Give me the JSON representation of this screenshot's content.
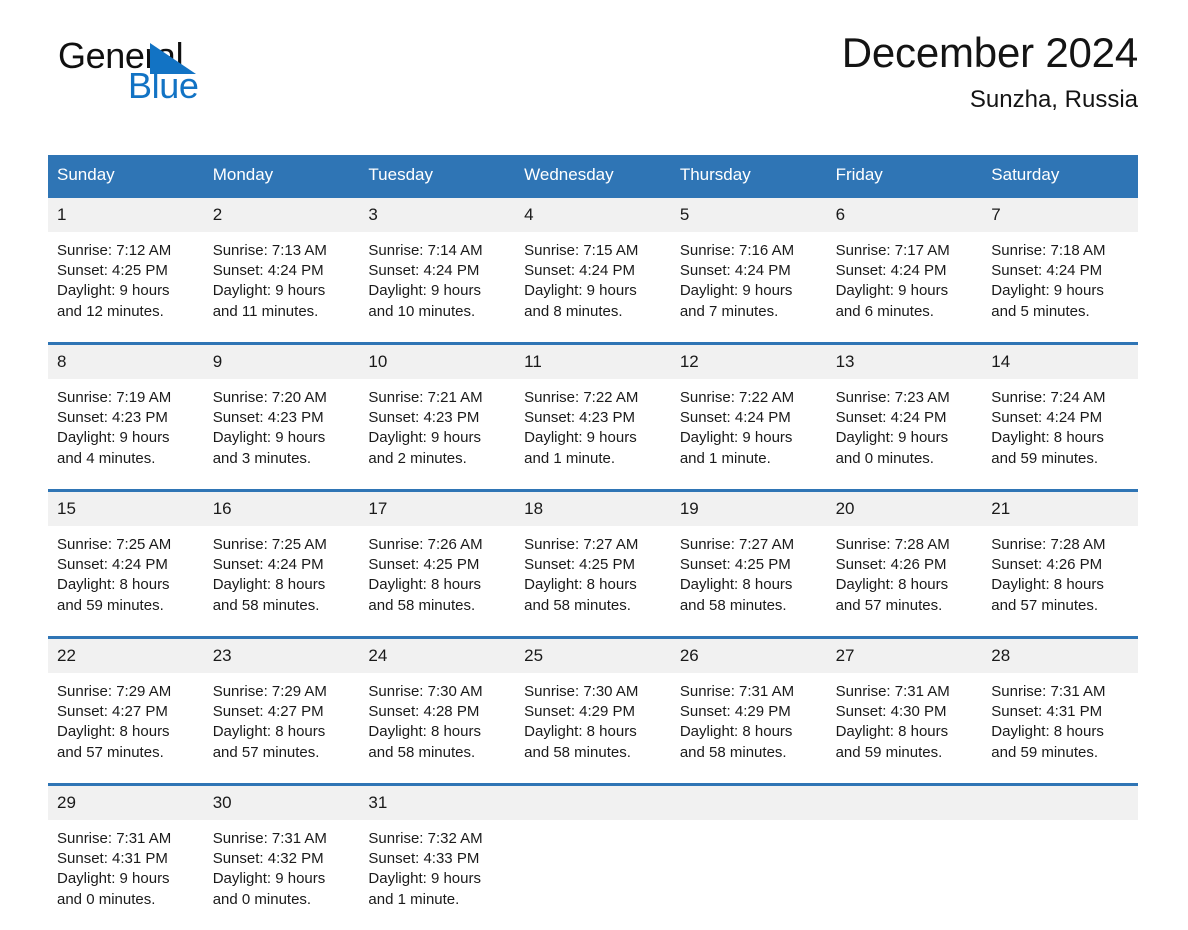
{
  "brand": {
    "name_dark": "General",
    "name_blue": "Blue",
    "triangle_icon": "brand-triangle-icon",
    "colors": {
      "blue": "#1273c4",
      "dark": "#101010"
    }
  },
  "header": {
    "title": "December 2024",
    "subtitle": "Sunzha, Russia"
  },
  "theme": {
    "header_blue": "#2f75b5",
    "daynum_band": "#f1f1f1",
    "text": "#1a1a1a"
  },
  "calendar": {
    "weekdays": [
      "Sunday",
      "Monday",
      "Tuesday",
      "Wednesday",
      "Thursday",
      "Friday",
      "Saturday"
    ],
    "weeks": [
      {
        "numbers": [
          "1",
          "2",
          "3",
          "4",
          "5",
          "6",
          "7"
        ],
        "cells": [
          {
            "sunrise": "Sunrise: 7:12 AM",
            "sunset": "Sunset: 4:25 PM",
            "daylight1": "Daylight: 9 hours",
            "daylight2": "and 12 minutes."
          },
          {
            "sunrise": "Sunrise: 7:13 AM",
            "sunset": "Sunset: 4:24 PM",
            "daylight1": "Daylight: 9 hours",
            "daylight2": "and 11 minutes."
          },
          {
            "sunrise": "Sunrise: 7:14 AM",
            "sunset": "Sunset: 4:24 PM",
            "daylight1": "Daylight: 9 hours",
            "daylight2": "and 10 minutes."
          },
          {
            "sunrise": "Sunrise: 7:15 AM",
            "sunset": "Sunset: 4:24 PM",
            "daylight1": "Daylight: 9 hours",
            "daylight2": "and 8 minutes."
          },
          {
            "sunrise": "Sunrise: 7:16 AM",
            "sunset": "Sunset: 4:24 PM",
            "daylight1": "Daylight: 9 hours",
            "daylight2": "and 7 minutes."
          },
          {
            "sunrise": "Sunrise: 7:17 AM",
            "sunset": "Sunset: 4:24 PM",
            "daylight1": "Daylight: 9 hours",
            "daylight2": "and 6 minutes."
          },
          {
            "sunrise": "Sunrise: 7:18 AM",
            "sunset": "Sunset: 4:24 PM",
            "daylight1": "Daylight: 9 hours",
            "daylight2": "and 5 minutes."
          }
        ]
      },
      {
        "numbers": [
          "8",
          "9",
          "10",
          "11",
          "12",
          "13",
          "14"
        ],
        "cells": [
          {
            "sunrise": "Sunrise: 7:19 AM",
            "sunset": "Sunset: 4:23 PM",
            "daylight1": "Daylight: 9 hours",
            "daylight2": "and 4 minutes."
          },
          {
            "sunrise": "Sunrise: 7:20 AM",
            "sunset": "Sunset: 4:23 PM",
            "daylight1": "Daylight: 9 hours",
            "daylight2": "and 3 minutes."
          },
          {
            "sunrise": "Sunrise: 7:21 AM",
            "sunset": "Sunset: 4:23 PM",
            "daylight1": "Daylight: 9 hours",
            "daylight2": "and 2 minutes."
          },
          {
            "sunrise": "Sunrise: 7:22 AM",
            "sunset": "Sunset: 4:23 PM",
            "daylight1": "Daylight: 9 hours",
            "daylight2": "and 1 minute."
          },
          {
            "sunrise": "Sunrise: 7:22 AM",
            "sunset": "Sunset: 4:24 PM",
            "daylight1": "Daylight: 9 hours",
            "daylight2": "and 1 minute."
          },
          {
            "sunrise": "Sunrise: 7:23 AM",
            "sunset": "Sunset: 4:24 PM",
            "daylight1": "Daylight: 9 hours",
            "daylight2": "and 0 minutes."
          },
          {
            "sunrise": "Sunrise: 7:24 AM",
            "sunset": "Sunset: 4:24 PM",
            "daylight1": "Daylight: 8 hours",
            "daylight2": "and 59 minutes."
          }
        ]
      },
      {
        "numbers": [
          "15",
          "16",
          "17",
          "18",
          "19",
          "20",
          "21"
        ],
        "cells": [
          {
            "sunrise": "Sunrise: 7:25 AM",
            "sunset": "Sunset: 4:24 PM",
            "daylight1": "Daylight: 8 hours",
            "daylight2": "and 59 minutes."
          },
          {
            "sunrise": "Sunrise: 7:25 AM",
            "sunset": "Sunset: 4:24 PM",
            "daylight1": "Daylight: 8 hours",
            "daylight2": "and 58 minutes."
          },
          {
            "sunrise": "Sunrise: 7:26 AM",
            "sunset": "Sunset: 4:25 PM",
            "daylight1": "Daylight: 8 hours",
            "daylight2": "and 58 minutes."
          },
          {
            "sunrise": "Sunrise: 7:27 AM",
            "sunset": "Sunset: 4:25 PM",
            "daylight1": "Daylight: 8 hours",
            "daylight2": "and 58 minutes."
          },
          {
            "sunrise": "Sunrise: 7:27 AM",
            "sunset": "Sunset: 4:25 PM",
            "daylight1": "Daylight: 8 hours",
            "daylight2": "and 58 minutes."
          },
          {
            "sunrise": "Sunrise: 7:28 AM",
            "sunset": "Sunset: 4:26 PM",
            "daylight1": "Daylight: 8 hours",
            "daylight2": "and 57 minutes."
          },
          {
            "sunrise": "Sunrise: 7:28 AM",
            "sunset": "Sunset: 4:26 PM",
            "daylight1": "Daylight: 8 hours",
            "daylight2": "and 57 minutes."
          }
        ]
      },
      {
        "numbers": [
          "22",
          "23",
          "24",
          "25",
          "26",
          "27",
          "28"
        ],
        "cells": [
          {
            "sunrise": "Sunrise: 7:29 AM",
            "sunset": "Sunset: 4:27 PM",
            "daylight1": "Daylight: 8 hours",
            "daylight2": "and 57 minutes."
          },
          {
            "sunrise": "Sunrise: 7:29 AM",
            "sunset": "Sunset: 4:27 PM",
            "daylight1": "Daylight: 8 hours",
            "daylight2": "and 57 minutes."
          },
          {
            "sunrise": "Sunrise: 7:30 AM",
            "sunset": "Sunset: 4:28 PM",
            "daylight1": "Daylight: 8 hours",
            "daylight2": "and 58 minutes."
          },
          {
            "sunrise": "Sunrise: 7:30 AM",
            "sunset": "Sunset: 4:29 PM",
            "daylight1": "Daylight: 8 hours",
            "daylight2": "and 58 minutes."
          },
          {
            "sunrise": "Sunrise: 7:31 AM",
            "sunset": "Sunset: 4:29 PM",
            "daylight1": "Daylight: 8 hours",
            "daylight2": "and 58 minutes."
          },
          {
            "sunrise": "Sunrise: 7:31 AM",
            "sunset": "Sunset: 4:30 PM",
            "daylight1": "Daylight: 8 hours",
            "daylight2": "and 59 minutes."
          },
          {
            "sunrise": "Sunrise: 7:31 AM",
            "sunset": "Sunset: 4:31 PM",
            "daylight1": "Daylight: 8 hours",
            "daylight2": "and 59 minutes."
          }
        ]
      },
      {
        "numbers": [
          "29",
          "30",
          "31",
          "",
          "",
          "",
          ""
        ],
        "cells": [
          {
            "sunrise": "Sunrise: 7:31 AM",
            "sunset": "Sunset: 4:31 PM",
            "daylight1": "Daylight: 9 hours",
            "daylight2": "and 0 minutes."
          },
          {
            "sunrise": "Sunrise: 7:31 AM",
            "sunset": "Sunset: 4:32 PM",
            "daylight1": "Daylight: 9 hours",
            "daylight2": "and 0 minutes."
          },
          {
            "sunrise": "Sunrise: 7:32 AM",
            "sunset": "Sunset: 4:33 PM",
            "daylight1": "Daylight: 9 hours",
            "daylight2": "and 1 minute."
          },
          {
            "sunrise": "",
            "sunset": "",
            "daylight1": "",
            "daylight2": ""
          },
          {
            "sunrise": "",
            "sunset": "",
            "daylight1": "",
            "daylight2": ""
          },
          {
            "sunrise": "",
            "sunset": "",
            "daylight1": "",
            "daylight2": ""
          },
          {
            "sunrise": "",
            "sunset": "",
            "daylight1": "",
            "daylight2": ""
          }
        ]
      }
    ]
  }
}
